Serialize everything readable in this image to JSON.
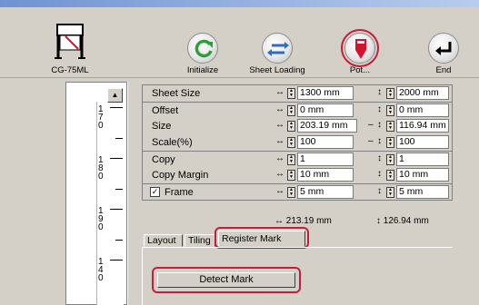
{
  "toolbar": {
    "device_label": "CG-75ML",
    "initialize_label": "Initialize",
    "sheet_loading_label": "Sheet Loading",
    "pot_label": "Pot...",
    "end_label": "End"
  },
  "ruler": {
    "numbers": [
      "170",
      "180",
      "190",
      "140"
    ]
  },
  "settings": {
    "sheet_size": {
      "label": "Sheet Size",
      "h_value": "1300 mm",
      "v_value": "2000 mm"
    },
    "offset": {
      "label": "Offset",
      "h_value": "0 mm",
      "v_value": "0 mm"
    },
    "size": {
      "label": "Size",
      "h_value": "203.19 mm",
      "v_value": "116.94 mm"
    },
    "scale": {
      "label": "Scale(%)",
      "h_value": "100",
      "v_value": "100"
    },
    "copy": {
      "label": "Copy",
      "h_value": "1",
      "v_value": "1"
    },
    "copy_margin": {
      "label": "Copy Margin",
      "h_value": "10 mm",
      "v_value": "10 mm"
    },
    "frame": {
      "label": "Frame",
      "checked": true,
      "h_value": "5 mm",
      "v_value": "5 mm"
    },
    "totals": {
      "h_total": "↔ 213.19 mm",
      "v_total": "↕ 126.94 mm"
    }
  },
  "tabs": [
    {
      "label": "Layout"
    },
    {
      "label": "Tiling"
    },
    {
      "label": "Register Mark",
      "active": true
    }
  ],
  "detect_mark_label": "Detect Mark",
  "colors": {
    "highlight": "#c41e3a",
    "green_icon": "#2e9e3c",
    "blue_icon": "#2f6dc0",
    "red_icon": "#d4142e"
  }
}
